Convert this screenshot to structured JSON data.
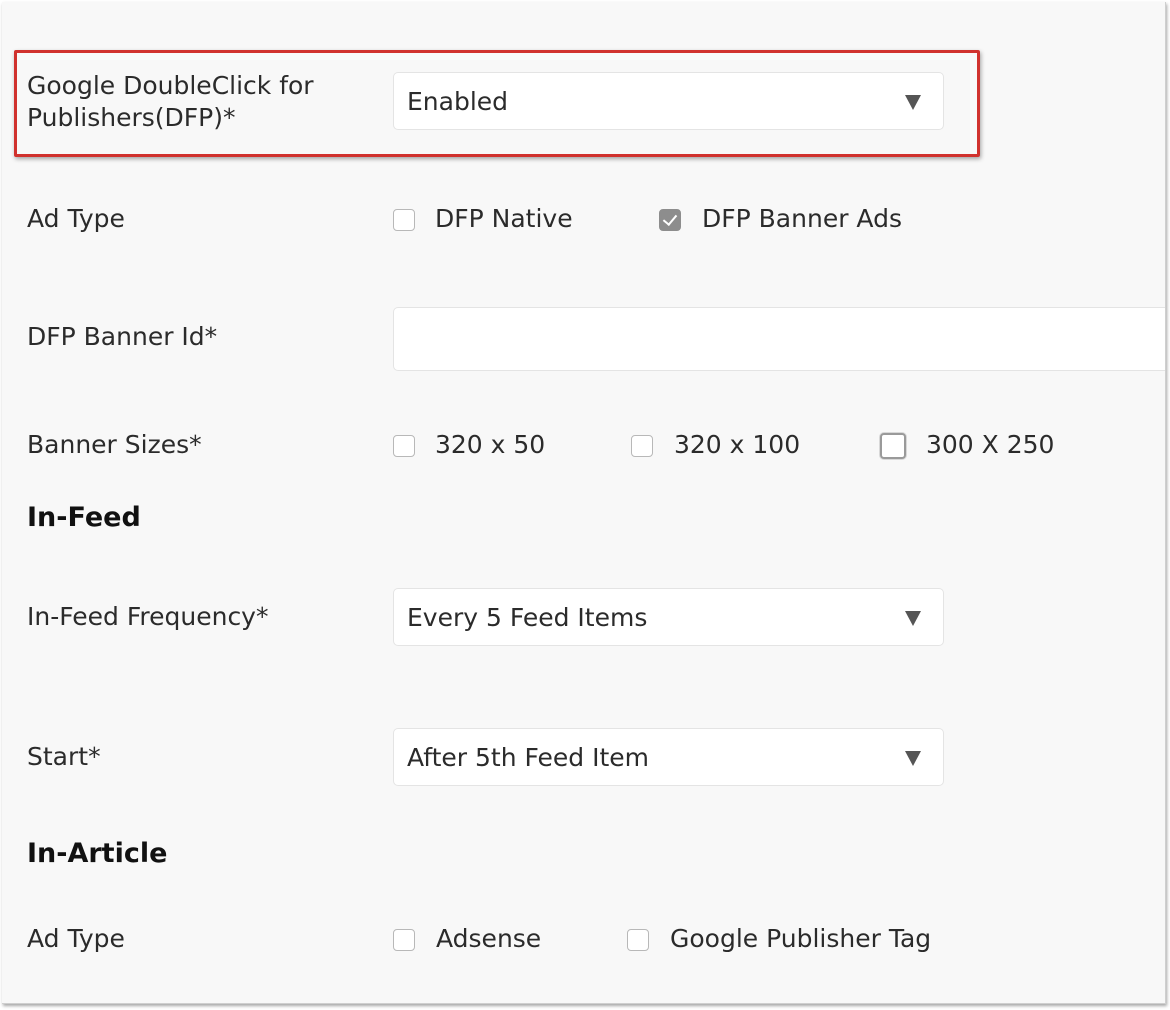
{
  "dfp": {
    "label_line1": "Google DoubleClick for",
    "label_line2": "Publishers(DFP)*",
    "value": "Enabled",
    "highlight_color": "#d0312d"
  },
  "ad_type": {
    "label": "Ad Type",
    "options": [
      {
        "label": "DFP Native",
        "checked": false
      },
      {
        "label": "DFP Banner Ads",
        "checked": true
      }
    ]
  },
  "banner_id": {
    "label": "DFP Banner Id*",
    "value": ""
  },
  "banner_sizes": {
    "label": "Banner Sizes*",
    "options": [
      {
        "label": "320 x 50",
        "checked": false
      },
      {
        "label": "320 x 100",
        "checked": false
      },
      {
        "label": "300 X 250",
        "checked": false
      }
    ]
  },
  "in_feed": {
    "heading": "In-Feed",
    "frequency": {
      "label": "In-Feed Frequency*",
      "value": "Every 5 Feed Items"
    },
    "start": {
      "label": "Start*",
      "value": "After 5th Feed Item"
    }
  },
  "in_article": {
    "heading": "In-Article",
    "ad_type": {
      "label": "Ad Type",
      "options": [
        {
          "label": "Adsense",
          "checked": false
        },
        {
          "label": "Google Publisher Tag",
          "checked": false
        }
      ]
    }
  }
}
